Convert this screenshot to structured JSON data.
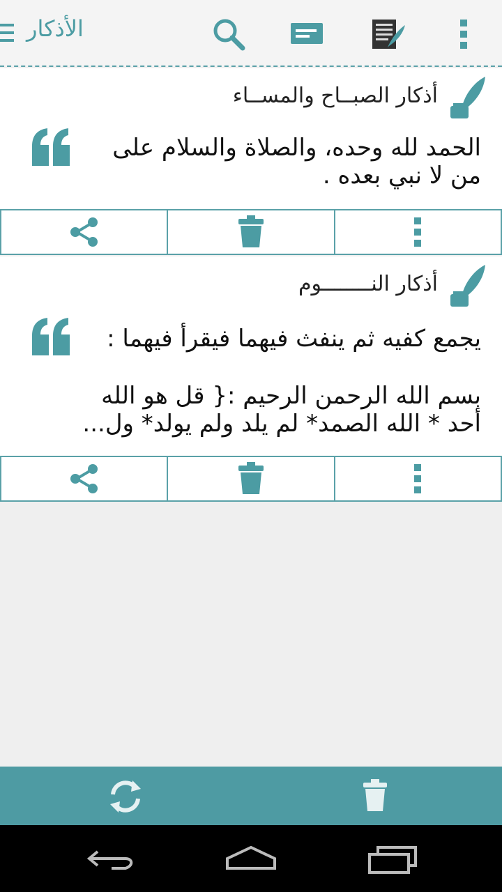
{
  "app": {
    "title": "الأذكار"
  },
  "toolbar": {
    "icons": [
      "menu-icon",
      "search-icon",
      "list-icon",
      "notes-quill-icon",
      "overflow-icon"
    ]
  },
  "cards": [
    {
      "title": "أذكار الصبــاح والمســاء",
      "body_line1": "الحمد لله وحده، والصلاة والسلام على",
      "body_line2": "من لا نبي بعده ."
    },
    {
      "title": "أذكار النــــــــوم",
      "body_line1": "يجمع كفيه ثم ينفث فيهما فيقرأ فيهما :",
      "body_line2": "بسم الله الرحمن الرحيم :{ قل هو الله",
      "body_line3": "أحد * الله الصمد* لم يلد ولم يولد* ول..."
    }
  ],
  "colors": {
    "accent": "#4c9ca3",
    "bottombar": "#4e9ba3",
    "background": "#efefef"
  }
}
